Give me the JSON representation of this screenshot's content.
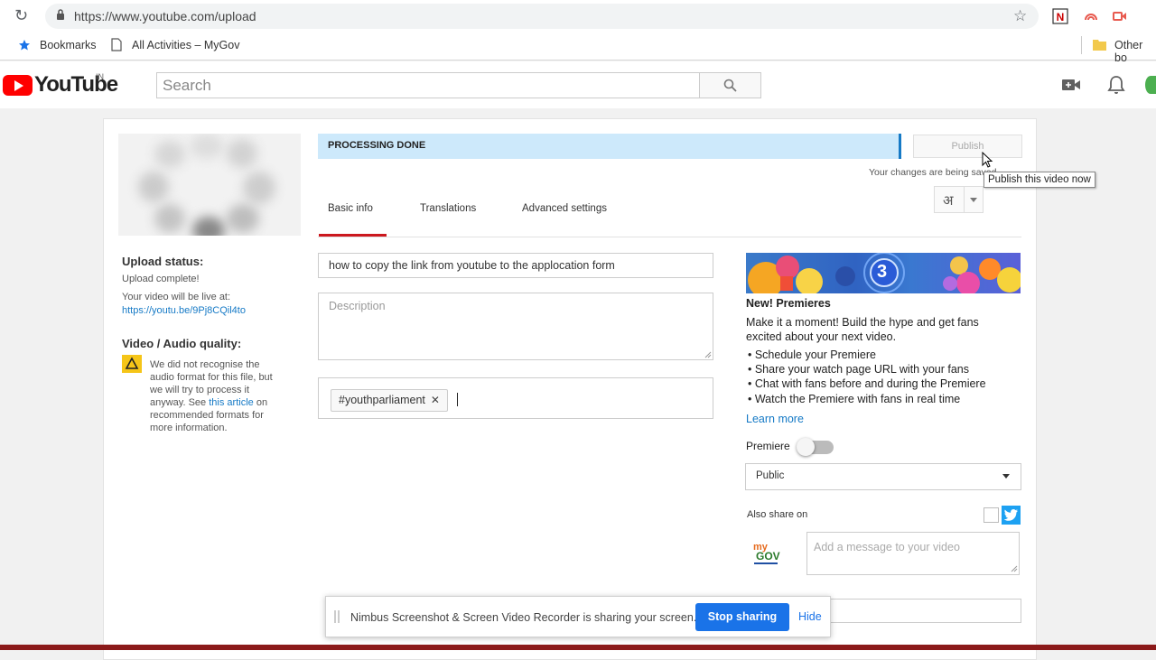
{
  "browser": {
    "url": "https://www.youtube.com/upload",
    "bookmarks": [
      "Bookmarks",
      "All Activities – MyGov",
      "Other bo"
    ]
  },
  "header": {
    "logo_text": "YouTube",
    "country": "IN",
    "search_placeholder": "Search"
  },
  "sidebar": {
    "upload_status_heading": "Upload status:",
    "upload_status": "Upload complete!",
    "live_at_text": "Your video will be live at:",
    "video_link": "https://youtu.be/9Pj8CQil4to",
    "quality_heading": "Video / Audio quality:",
    "quality_msg_1": "We did not recognise the audio format for this file, but we will try to process it anyway. See",
    "quality_link": "this article",
    "quality_msg_2": "on recommended formats for more information."
  },
  "progress": {
    "label": "PROCESSING DONE",
    "percent": 92
  },
  "publish": {
    "button_label": "Publish",
    "status_text": "Your changes are being saved.",
    "tooltip": "Publish this video now",
    "language_glyph": "अ"
  },
  "tabs": [
    "Basic info",
    "Translations",
    "Advanced settings"
  ],
  "form": {
    "title_value": "how to copy the link from youtube to the applocation form",
    "description_placeholder": "Description",
    "tags": [
      "#youthparliament"
    ]
  },
  "premieres": {
    "banner_number": "3",
    "title": "New! Premieres",
    "body": "Make it a moment! Build the hype and get fans excited about your next video.",
    "bullets": [
      "• Schedule your Premiere",
      "• Share your watch page URL with your fans",
      "• Chat with fans before and during the Premiere",
      "• Watch the Premiere with fans in real time"
    ],
    "learn_more": "Learn more",
    "toggle_label": "Premiere",
    "toggle_on": false
  },
  "privacy": {
    "selected": "Public"
  },
  "share": {
    "label": "Also share on",
    "mygov_label": "my GOV",
    "message_placeholder": "Add a message to your video"
  },
  "nimbus": {
    "text": "Nimbus Screenshot & Screen Video Recorder is sharing your screen.",
    "stop_label": "Stop sharing",
    "hide_label": "Hide"
  },
  "colors": {
    "youtube_red": "#ff0000",
    "link_blue": "#167ac6",
    "progress_fill": "#cde9fb",
    "tab_active": "#cc181e",
    "nimbus_blue": "#1a73e8"
  }
}
